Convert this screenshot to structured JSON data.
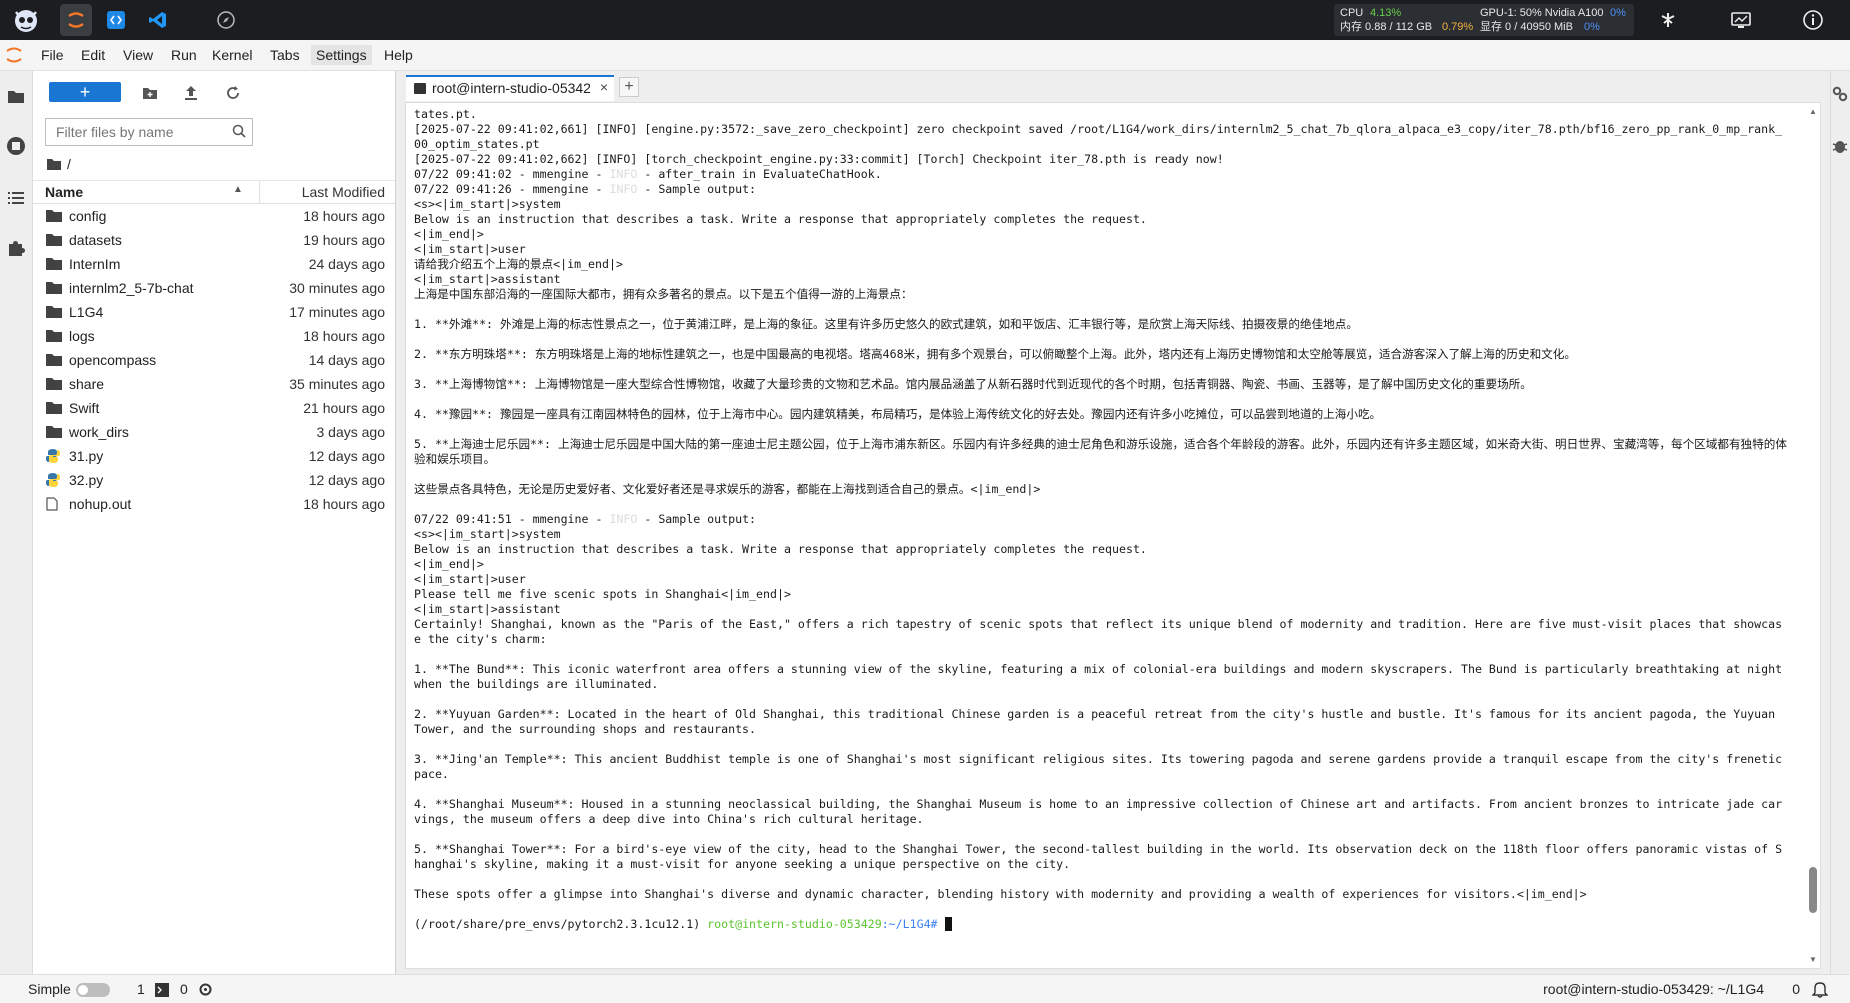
{
  "topbar": {
    "resource": {
      "cpu_label": "CPU",
      "cpu_value": "4.13%",
      "mem_label": "内存 0.88 / 112 GB",
      "mem_value": "0.79%",
      "gpu_label": "GPU-1: 50% Nvidia A100",
      "gpu_value": "0%",
      "vram_label": "显存 0 / 40950 MiB",
      "vram_value": "0%"
    }
  },
  "menu": {
    "items": [
      "File",
      "Edit",
      "View",
      "Run",
      "Kernel",
      "Tabs",
      "Settings",
      "Help"
    ]
  },
  "filebrowser": {
    "new_label": "+",
    "filter_placeholder": "Filter files by name",
    "crumb": "/",
    "col_name": "Name",
    "col_modified": "Last Modified",
    "files": [
      {
        "name": "config",
        "modified": "18 hours ago",
        "type": "folder"
      },
      {
        "name": "datasets",
        "modified": "19 hours ago",
        "type": "folder"
      },
      {
        "name": "InternIm",
        "modified": "24 days ago",
        "type": "folder"
      },
      {
        "name": "internlm2_5-7b-chat",
        "modified": "30 minutes ago",
        "type": "folder"
      },
      {
        "name": "L1G4",
        "modified": "17 minutes ago",
        "type": "folder"
      },
      {
        "name": "logs",
        "modified": "18 hours ago",
        "type": "folder"
      },
      {
        "name": "opencompass",
        "modified": "14 days ago",
        "type": "folder"
      },
      {
        "name": "share",
        "modified": "35 minutes ago",
        "type": "folder"
      },
      {
        "name": "Swift",
        "modified": "21 hours ago",
        "type": "folder"
      },
      {
        "name": "work_dirs",
        "modified": "3 days ago",
        "type": "folder"
      },
      {
        "name": "31.py",
        "modified": "12 days ago",
        "type": "python"
      },
      {
        "name": "32.py",
        "modified": "12 days ago",
        "type": "python"
      },
      {
        "name": "nohup.out",
        "modified": "18 hours ago",
        "type": "file"
      }
    ]
  },
  "tabs": {
    "terminal_title": "root@intern-studio-05342",
    "close": "×",
    "add": "+"
  },
  "terminal": {
    "lines": [
      "tates.pt.",
      "[2025-07-22 09:41:02,661] [INFO] [engine.py:3572:_save_zero_checkpoint] zero checkpoint saved /root/L1G4/work_dirs/internlm2_5_chat_7b_qlora_alpaca_e3_copy/iter_78.pth/bf16_zero_pp_rank_0_mp_rank_00_optim_states.pt",
      "[2025-07-22 09:41:02,662] [INFO] [torch_checkpoint_engine.py:33:commit] [Torch] Checkpoint iter_78.pth is ready now!",
      "07/22 09:41:02 - mmengine - |INFO| - after_train in EvaluateChatHook.",
      "07/22 09:41:26 - mmengine - |INFO| - Sample output:",
      "<s><|im_start|>system",
      "Below is an instruction that describes a task. Write a response that appropriately completes the request.",
      "<|im_end|>",
      "<|im_start|>user",
      "请给我介绍五个上海的景点<|im_end|>",
      "<|im_start|>assistant",
      "上海是中国东部沿海的一座国际大都市，拥有众多著名的景点。以下是五个值得一游的上海景点：",
      "",
      "1. **外滩**: 外滩是上海的标志性景点之一，位于黄浦江畔，是上海的象征。这里有许多历史悠久的欧式建筑，如和平饭店、汇丰银行等，是欣赏上海天际线、拍摄夜景的绝佳地点。",
      "",
      "2. **东方明珠塔**: 东方明珠塔是上海的地标性建筑之一，也是中国最高的电视塔。塔高468米，拥有多个观景台，可以俯瞰整个上海。此外，塔内还有上海历史博物馆和太空舱等展览，适合游客深入了解上海的历史和文化。",
      "",
      "3. **上海博物馆**: 上海博物馆是一座大型综合性博物馆，收藏了大量珍贵的文物和艺术品。馆内展品涵盖了从新石器时代到近现代的各个时期，包括青铜器、陶瓷、书画、玉器等，是了解中国历史文化的重要场所。",
      "",
      "4. **豫园**: 豫园是一座具有江南园林特色的园林，位于上海市中心。园内建筑精美，布局精巧，是体验上海传统文化的好去处。豫园内还有许多小吃摊位，可以品尝到地道的上海小吃。",
      "",
      "5. **上海迪士尼乐园**: 上海迪士尼乐园是中国大陆的第一座迪士尼主题公园，位于上海市浦东新区。乐园内有许多经典的迪士尼角色和游乐设施，适合各个年龄段的游客。此外，乐园内还有许多主题区域，如米奇大街、明日世界、宝藏湾等，每个区域都有独特的体验和娱乐项目。",
      "",
      "这些景点各具特色，无论是历史爱好者、文化爱好者还是寻求娱乐的游客，都能在上海找到适合自己的景点。<|im_end|>",
      "",
      "07/22 09:41:51 - mmengine - |INFO| - Sample output:",
      "<s><|im_start|>system",
      "Below is an instruction that describes a task. Write a response that appropriately completes the request.",
      "<|im_end|>",
      "<|im_start|>user",
      "Please tell me five scenic spots in Shanghai<|im_end|>",
      "<|im_start|>assistant",
      "Certainly! Shanghai, known as the \"Paris of the East,\" offers a rich tapestry of scenic spots that reflect its unique blend of modernity and tradition. Here are five must-visit places that showcase the city's charm:",
      "",
      "1. **The Bund**: This iconic waterfront area offers a stunning view of the skyline, featuring a mix of colonial-era buildings and modern skyscrapers. The Bund is particularly breathtaking at night when the buildings are illuminated.",
      "",
      "2. **Yuyuan Garden**: Located in the heart of Old Shanghai, this traditional Chinese garden is a peaceful retreat from the city's hustle and bustle. It's famous for its ancient pagoda, the Yuyuan Tower, and the surrounding shops and restaurants.",
      "",
      "3. **Jing'an Temple**: This ancient Buddhist temple is one of Shanghai's most significant religious sites. Its towering pagoda and serene gardens provide a tranquil escape from the city's frenetic pace.",
      "",
      "4. **Shanghai Museum**: Housed in a stunning neoclassical building, the Shanghai Museum is home to an impressive collection of Chinese art and artifacts. From ancient bronzes to intricate jade carvings, the museum offers a deep dive into China's rich cultural heritage.",
      "",
      "5. **Shanghai Tower**: For a bird's-eye view of the city, head to the Shanghai Tower, the second-tallest building in the world. Its observation deck on the 118th floor offers panoramic vistas of Shanghai's skyline, making it a must-visit for anyone seeking a unique perspective on the city.",
      "",
      "These spots offer a glimpse into Shanghai's diverse and dynamic character, blending history with modernity and providing a wealth of experiences for visitors.<|im_end|>",
      ""
    ],
    "prompt_env": "(/root/share/pre_envs/pytorch2.3.1cu12.1)",
    "prompt_user": "root@intern-studio-053429",
    "prompt_path": ":~/L1G4#",
    "scroll_fraction": 0.95
  },
  "statusbar": {
    "mode": "Simple",
    "terminals": "1",
    "kernels": "0",
    "right_text": "root@intern-studio-053429: ~/L1G4",
    "notifications": "0"
  }
}
